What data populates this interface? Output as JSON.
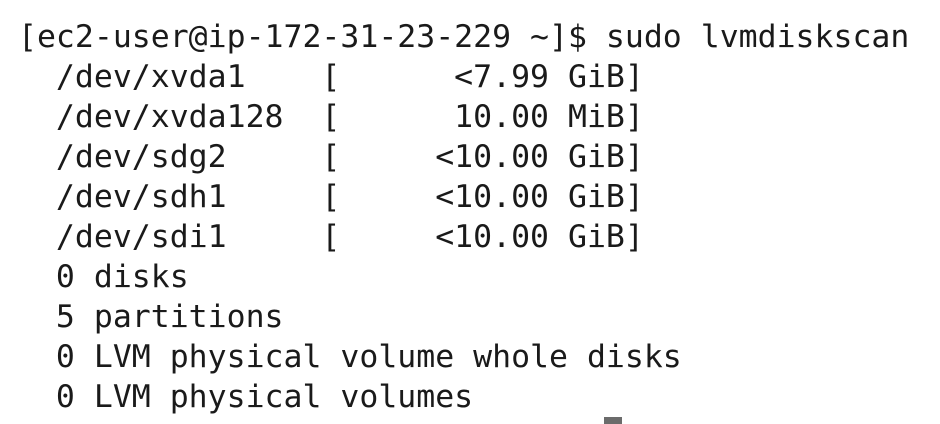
{
  "terminal": {
    "prompt": "[ec2-user@ip-172-31-23-229 ~]$ ",
    "command": "sudo lvmdiskscan",
    "output_lines": [
      "  /dev/xvda1    [      <7.99 GiB]",
      "  /dev/xvda128  [      10.00 MiB]",
      "  /dev/sdg2     [     <10.00 GiB]",
      "  /dev/sdh1     [     <10.00 GiB]",
      "  /dev/sdi1     [     <10.00 GiB]",
      "  0 disks",
      "  5 partitions",
      "  0 LVM physical volume whole disks",
      "  0 LVM physical volumes"
    ]
  }
}
